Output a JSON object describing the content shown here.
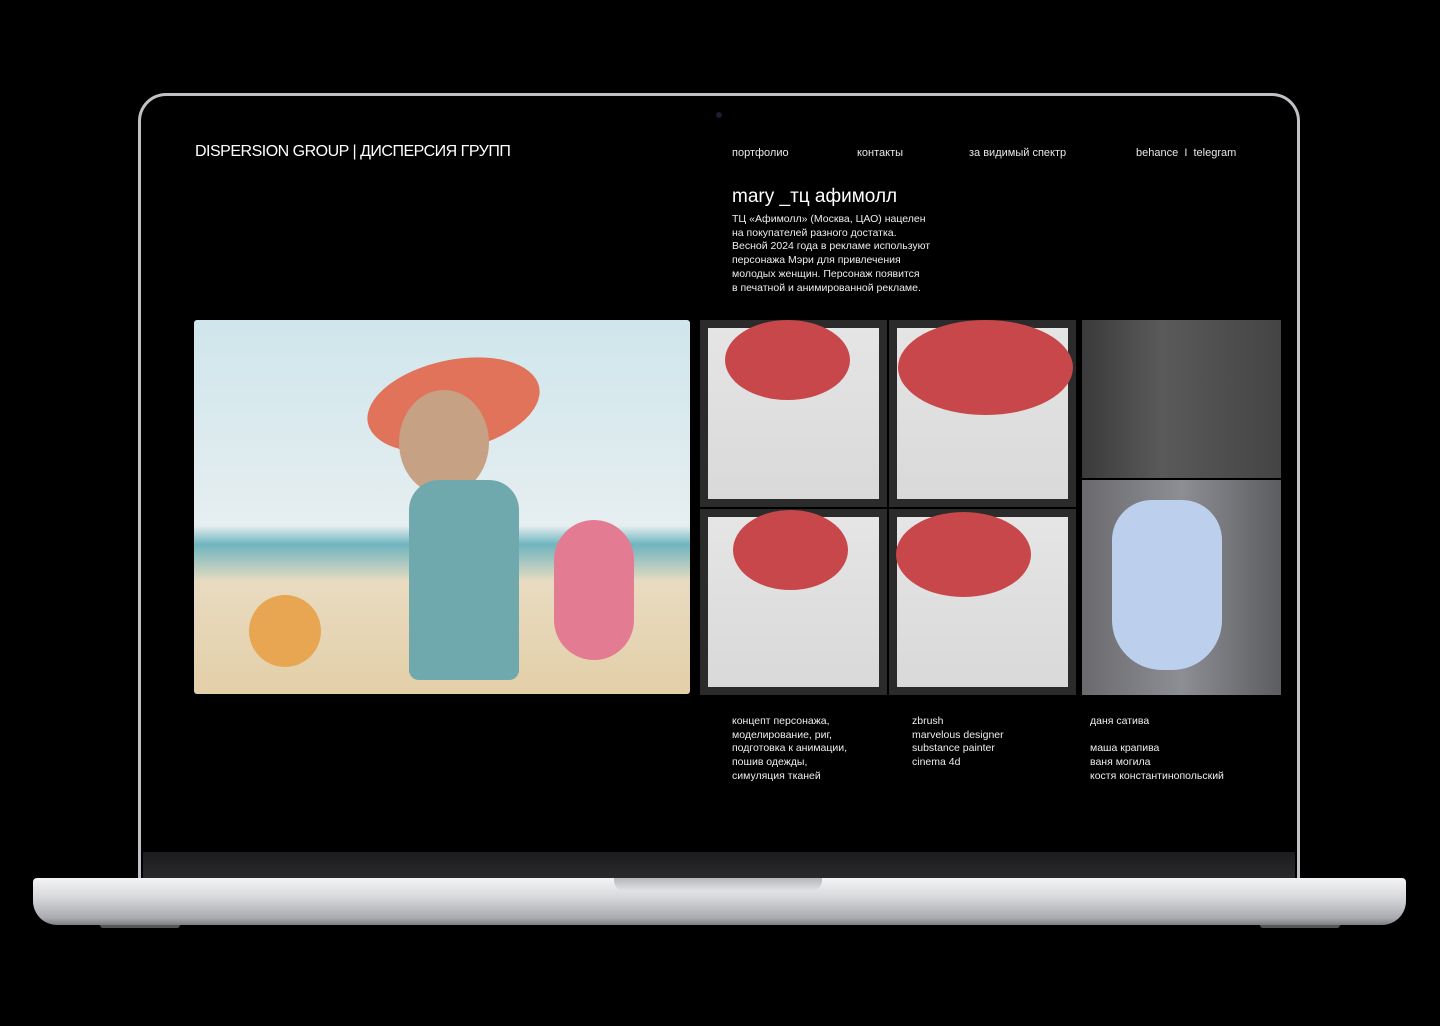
{
  "header": {
    "logo": "DISPERSION GROUP | ДИСПЕРСИЯ ГРУПП",
    "nav": [
      "портфолио",
      "контакты",
      "за видимый спектр"
    ],
    "social": "behance  I  telegram"
  },
  "project": {
    "title": "mary _тц афимолл",
    "description": [
      "ТЦ «Афимолл» (Москва, ЦАО) нацелен",
      "на покупателей разного достатка.",
      "Весной 2024 года в рекламе используют",
      "персонажа Мэри для привлечения",
      "молодых женщин. Персонаж появится",
      "в печатной и анимированной рекламе."
    ]
  },
  "credits": {
    "work": [
      "концепт персонажа,",
      "моделирование, риг,",
      "подготовка к анимации,",
      "пошив одежды,",
      "симуляция тканей"
    ],
    "software": [
      "zbrush",
      "marvelous designer",
      "substance painter",
      "cinema 4d"
    ],
    "team": [
      "даня сатива",
      "",
      "маша крапива",
      "ваня могила",
      "костя константинопольский"
    ]
  }
}
